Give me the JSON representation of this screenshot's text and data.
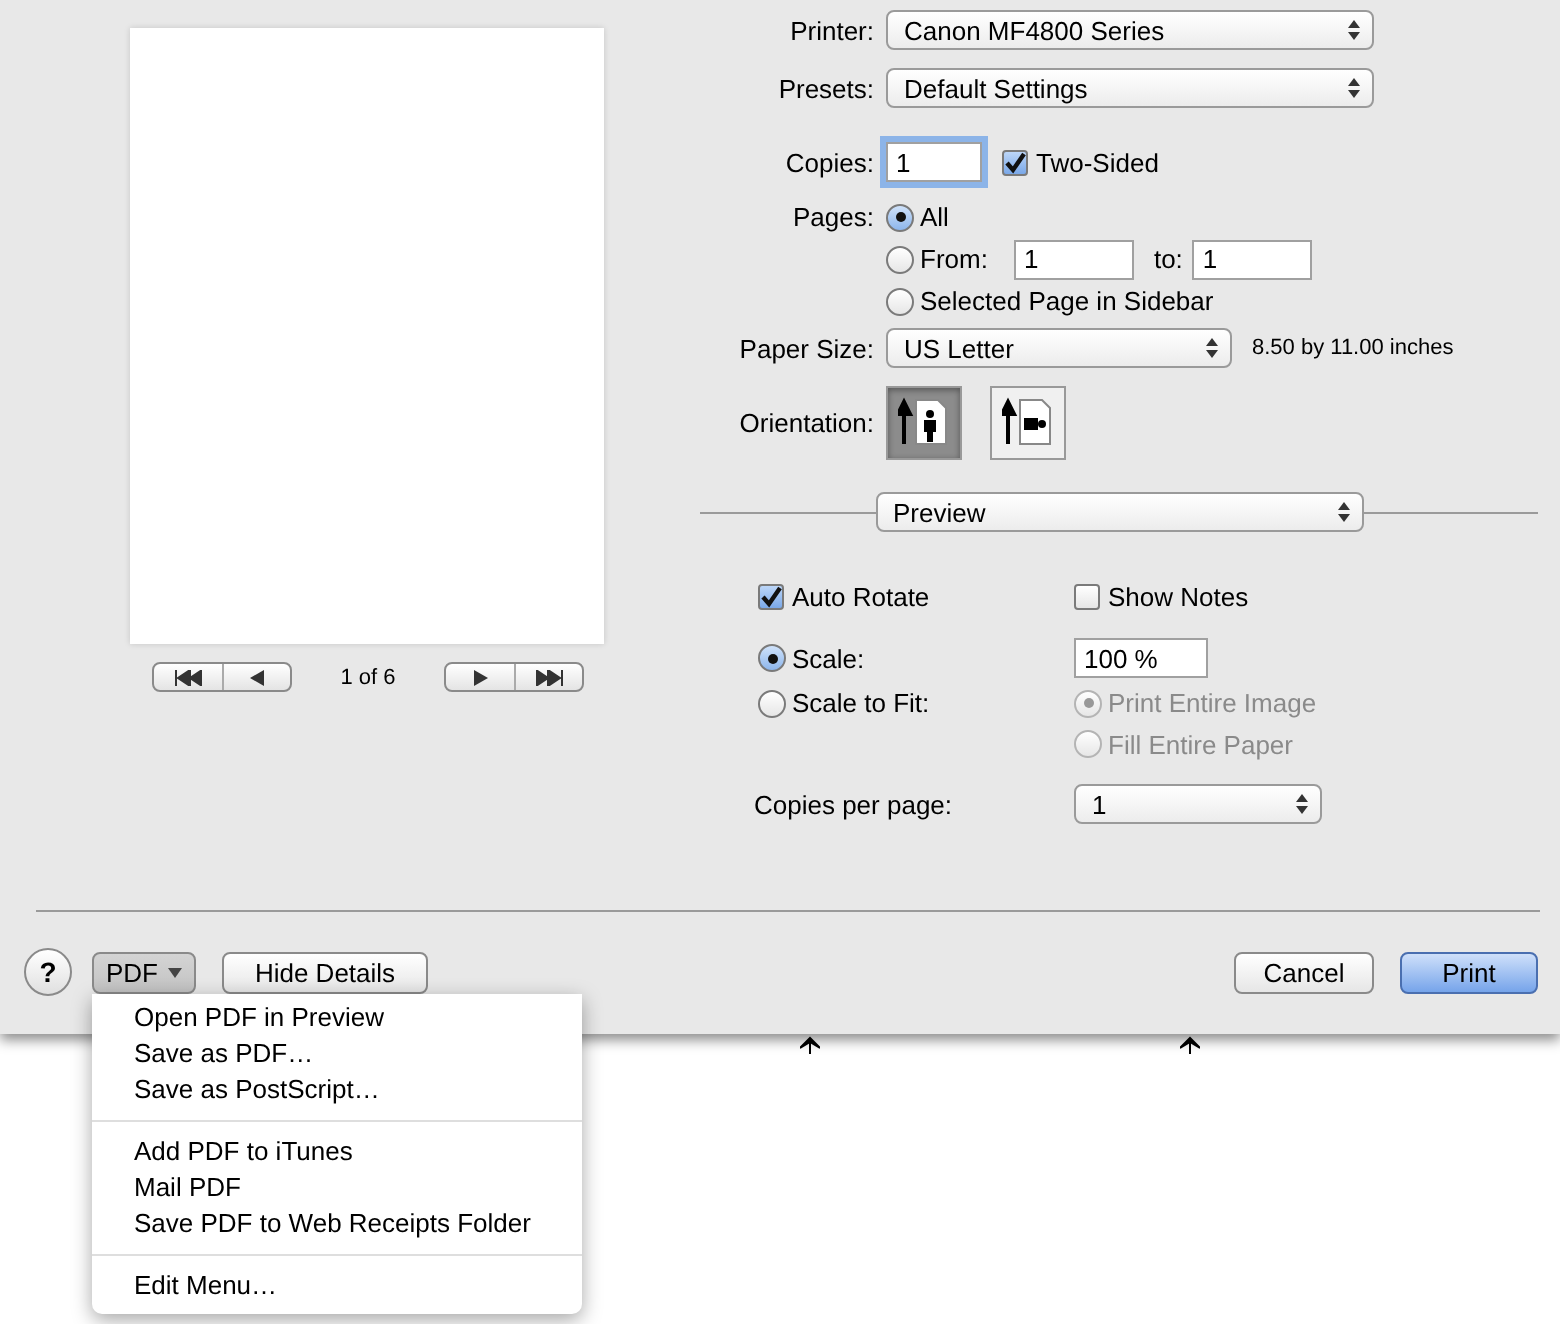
{
  "preview": {
    "page_indicator": "1 of 6"
  },
  "printer": {
    "label": "Printer:",
    "value": "Canon MF4800 Series"
  },
  "presets": {
    "label": "Presets:",
    "value": "Default Settings"
  },
  "copies": {
    "label": "Copies:",
    "value": "1",
    "two_sided": {
      "label": "Two-Sided",
      "checked": true
    }
  },
  "pages": {
    "label": "Pages:",
    "options": [
      {
        "kind": "plain",
        "label": "All",
        "selected": true
      },
      {
        "kind": "range",
        "label": "From:",
        "selected": false,
        "from": "1",
        "to_label": "to:",
        "to": "1"
      },
      {
        "kind": "plain",
        "label": "Selected Page in Sidebar",
        "selected": false
      }
    ]
  },
  "paper_size": {
    "label": "Paper Size:",
    "value": "US Letter",
    "dimensions": "8.50 by 11.00 inches"
  },
  "orientation": {
    "label": "Orientation:",
    "options": [
      {
        "kind": "portrait",
        "selected": true
      },
      {
        "kind": "landscape",
        "selected": false
      }
    ]
  },
  "section": {
    "value": "Preview"
  },
  "auto_rotate": {
    "label": "Auto Rotate",
    "checked": true
  },
  "show_notes": {
    "label": "Show Notes",
    "checked": false
  },
  "scale_options": [
    {
      "label": "Scale:",
      "selected": true
    },
    {
      "label": "Scale to Fit:",
      "selected": false
    }
  ],
  "scale_value": "100 %",
  "fit_options": [
    {
      "label": "Print Entire Image",
      "selected": true,
      "disabled": true
    },
    {
      "label": "Fill Entire Paper",
      "selected": false,
      "disabled": true
    }
  ],
  "copies_per_page": {
    "label": "Copies per page:",
    "value": "1"
  },
  "footer": {
    "help": "?",
    "pdf": "PDF",
    "hide_details": "Hide Details",
    "cancel": "Cancel",
    "print": "Print"
  },
  "pdf_menu": [
    [
      {
        "label": "Open PDF in Preview"
      },
      {
        "label": "Save as PDF…"
      },
      {
        "label": "Save as PostScript…"
      }
    ],
    [
      {
        "label": "Add PDF to iTunes"
      },
      {
        "label": "Mail PDF"
      },
      {
        "label": "Save PDF to Web Receipts Folder"
      }
    ],
    [
      {
        "label": "Edit Menu…"
      }
    ]
  ]
}
